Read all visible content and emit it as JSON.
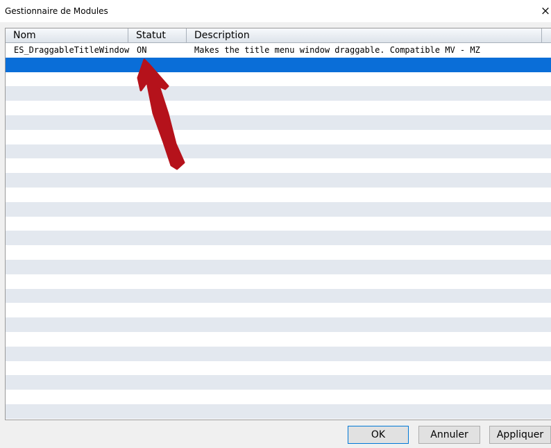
{
  "window": {
    "title": "Gestionnaire de Modules",
    "close_glyph": "×"
  },
  "table": {
    "columns": [
      "Nom",
      "Statut",
      "Description"
    ],
    "rows": [
      {
        "nom": "ES_DraggableTitleWindow",
        "statut": "ON",
        "description": "Makes the title menu window draggable. Compatible MV - MZ"
      }
    ],
    "selected_row": 2,
    "colors": {
      "selection": "#0a6ed8",
      "stripe": "#e3e8ef"
    }
  },
  "buttons": {
    "ok": "OK",
    "cancel": "Annuler",
    "apply": "Appliquer"
  },
  "annotation": {
    "type": "red-arrow",
    "color": "#b5121b",
    "points_to": "Statut ON"
  }
}
